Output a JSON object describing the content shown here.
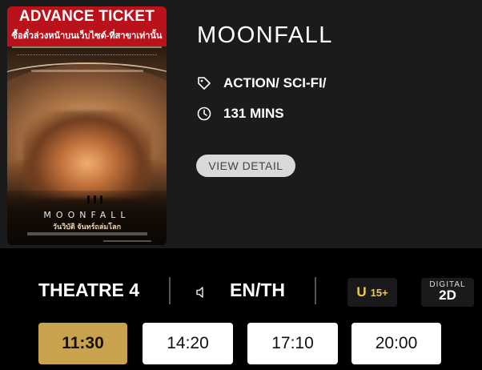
{
  "poster": {
    "banner_line1": "ADVANCE TICKET",
    "banner_line2": "ซื้อตั๋วล่วงหน้าบนเว็บไซต์-ที่สาขาเท่านั้น",
    "poster_title": "MOONFALL",
    "poster_subtitle": "วันวิบัติ จันทร์ถล่มโลก"
  },
  "movie": {
    "title": "MOONFALL",
    "genre": "ACTION/ SCI-FI/",
    "duration": "131 MINS",
    "view_detail_label": "VIEW DETAIL"
  },
  "showing": {
    "theatre": "THEATRE 4",
    "audio": "EN/TH",
    "rating_u": "U",
    "rating_age": "15+",
    "format_top": "DIGITAL",
    "format_main": "2D"
  },
  "showtimes": [
    "11:30",
    "14:20",
    "17:10",
    "20:00"
  ],
  "selected_showtime": "11:30",
  "colors": {
    "selected_time_bg": "#c9a24e",
    "rating_yellow": "#f2c94c",
    "banner_red": "#b9121b"
  }
}
